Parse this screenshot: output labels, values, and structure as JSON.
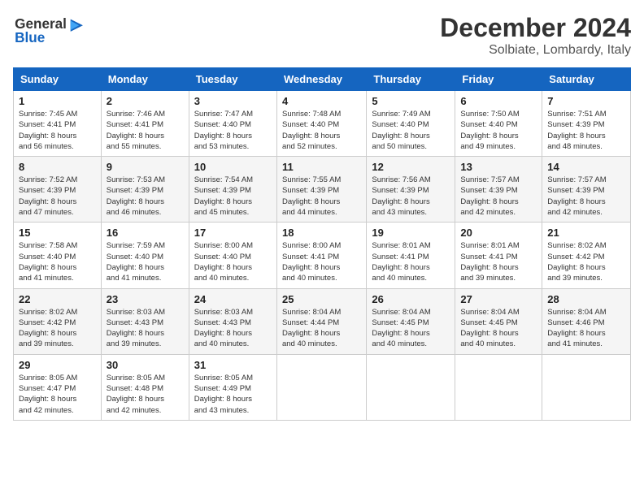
{
  "header": {
    "logo_line1": "General",
    "logo_line2": "Blue",
    "title": "December 2024",
    "subtitle": "Solbiate, Lombardy, Italy"
  },
  "weekdays": [
    "Sunday",
    "Monday",
    "Tuesday",
    "Wednesday",
    "Thursday",
    "Friday",
    "Saturday"
  ],
  "weeks": [
    [
      {
        "day": "1",
        "sunrise": "7:45 AM",
        "sunset": "4:41 PM",
        "daylight": "8 hours and 56 minutes."
      },
      {
        "day": "2",
        "sunrise": "7:46 AM",
        "sunset": "4:41 PM",
        "daylight": "8 hours and 55 minutes."
      },
      {
        "day": "3",
        "sunrise": "7:47 AM",
        "sunset": "4:40 PM",
        "daylight": "8 hours and 53 minutes."
      },
      {
        "day": "4",
        "sunrise": "7:48 AM",
        "sunset": "4:40 PM",
        "daylight": "8 hours and 52 minutes."
      },
      {
        "day": "5",
        "sunrise": "7:49 AM",
        "sunset": "4:40 PM",
        "daylight": "8 hours and 50 minutes."
      },
      {
        "day": "6",
        "sunrise": "7:50 AM",
        "sunset": "4:40 PM",
        "daylight": "8 hours and 49 minutes."
      },
      {
        "day": "7",
        "sunrise": "7:51 AM",
        "sunset": "4:39 PM",
        "daylight": "8 hours and 48 minutes."
      }
    ],
    [
      {
        "day": "8",
        "sunrise": "7:52 AM",
        "sunset": "4:39 PM",
        "daylight": "8 hours and 47 minutes."
      },
      {
        "day": "9",
        "sunrise": "7:53 AM",
        "sunset": "4:39 PM",
        "daylight": "8 hours and 46 minutes."
      },
      {
        "day": "10",
        "sunrise": "7:54 AM",
        "sunset": "4:39 PM",
        "daylight": "8 hours and 45 minutes."
      },
      {
        "day": "11",
        "sunrise": "7:55 AM",
        "sunset": "4:39 PM",
        "daylight": "8 hours and 44 minutes."
      },
      {
        "day": "12",
        "sunrise": "7:56 AM",
        "sunset": "4:39 PM",
        "daylight": "8 hours and 43 minutes."
      },
      {
        "day": "13",
        "sunrise": "7:57 AM",
        "sunset": "4:39 PM",
        "daylight": "8 hours and 42 minutes."
      },
      {
        "day": "14",
        "sunrise": "7:57 AM",
        "sunset": "4:39 PM",
        "daylight": "8 hours and 42 minutes."
      }
    ],
    [
      {
        "day": "15",
        "sunrise": "7:58 AM",
        "sunset": "4:40 PM",
        "daylight": "8 hours and 41 minutes."
      },
      {
        "day": "16",
        "sunrise": "7:59 AM",
        "sunset": "4:40 PM",
        "daylight": "8 hours and 41 minutes."
      },
      {
        "day": "17",
        "sunrise": "8:00 AM",
        "sunset": "4:40 PM",
        "daylight": "8 hours and 40 minutes."
      },
      {
        "day": "18",
        "sunrise": "8:00 AM",
        "sunset": "4:41 PM",
        "daylight": "8 hours and 40 minutes."
      },
      {
        "day": "19",
        "sunrise": "8:01 AM",
        "sunset": "4:41 PM",
        "daylight": "8 hours and 40 minutes."
      },
      {
        "day": "20",
        "sunrise": "8:01 AM",
        "sunset": "4:41 PM",
        "daylight": "8 hours and 39 minutes."
      },
      {
        "day": "21",
        "sunrise": "8:02 AM",
        "sunset": "4:42 PM",
        "daylight": "8 hours and 39 minutes."
      }
    ],
    [
      {
        "day": "22",
        "sunrise": "8:02 AM",
        "sunset": "4:42 PM",
        "daylight": "8 hours and 39 minutes."
      },
      {
        "day": "23",
        "sunrise": "8:03 AM",
        "sunset": "4:43 PM",
        "daylight": "8 hours and 39 minutes."
      },
      {
        "day": "24",
        "sunrise": "8:03 AM",
        "sunset": "4:43 PM",
        "daylight": "8 hours and 40 minutes."
      },
      {
        "day": "25",
        "sunrise": "8:04 AM",
        "sunset": "4:44 PM",
        "daylight": "8 hours and 40 minutes."
      },
      {
        "day": "26",
        "sunrise": "8:04 AM",
        "sunset": "4:45 PM",
        "daylight": "8 hours and 40 minutes."
      },
      {
        "day": "27",
        "sunrise": "8:04 AM",
        "sunset": "4:45 PM",
        "daylight": "8 hours and 40 minutes."
      },
      {
        "day": "28",
        "sunrise": "8:04 AM",
        "sunset": "4:46 PM",
        "daylight": "8 hours and 41 minutes."
      }
    ],
    [
      {
        "day": "29",
        "sunrise": "8:05 AM",
        "sunset": "4:47 PM",
        "daylight": "8 hours and 42 minutes."
      },
      {
        "day": "30",
        "sunrise": "8:05 AM",
        "sunset": "4:48 PM",
        "daylight": "8 hours and 42 minutes."
      },
      {
        "day": "31",
        "sunrise": "8:05 AM",
        "sunset": "4:49 PM",
        "daylight": "8 hours and 43 minutes."
      },
      null,
      null,
      null,
      null
    ]
  ],
  "labels": {
    "sunrise": "Sunrise: ",
    "sunset": "Sunset: ",
    "daylight": "Daylight: "
  }
}
